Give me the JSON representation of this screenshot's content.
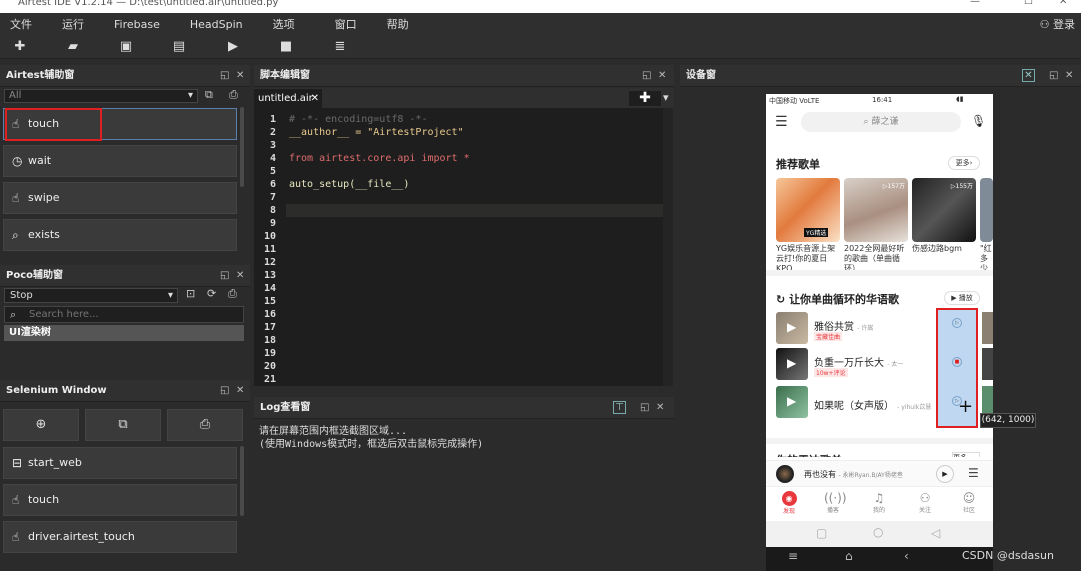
{
  "window": {
    "title": "Airtest IDE V1.2.14 — D:\\test\\untitled.air\\untitled.py"
  },
  "menu": [
    "文件",
    "运行",
    "Firebase",
    "HeadSpin",
    "选项",
    "窗口",
    "帮助"
  ],
  "login_label": "登录",
  "airtest_panel": {
    "title": "Airtest辅助窗",
    "filter": "All",
    "buttons": [
      "touch",
      "wait",
      "swipe",
      "exists"
    ]
  },
  "poco_panel": {
    "title": "Poco辅助窗",
    "mode": "Stop",
    "search_placeholder": "Search here...",
    "tree_item": "UI渲染树"
  },
  "selenium_panel": {
    "title": "Selenium Window",
    "buttons": [
      "start_web",
      "touch",
      "driver.airtest_touch"
    ]
  },
  "editor": {
    "title": "脚本编辑窗",
    "tab": "untitled.air",
    "lines": [
      {
        "n": "1",
        "text": "# -*- encoding=utf8 -*-"
      },
      {
        "n": "2",
        "text": "__author__ = \"AirtestProject\""
      },
      {
        "n": "3",
        "text": ""
      },
      {
        "n": "4",
        "text": "from airtest.core.api import *"
      },
      {
        "n": "5",
        "text": ""
      },
      {
        "n": "6",
        "text": "auto_setup(__file__)"
      },
      {
        "n": "7",
        "text": ""
      },
      {
        "n": "8",
        "text": ""
      },
      {
        "n": "9",
        "text": ""
      },
      {
        "n": "10",
        "text": ""
      },
      {
        "n": "11",
        "text": ""
      },
      {
        "n": "12",
        "text": ""
      },
      {
        "n": "13",
        "text": ""
      },
      {
        "n": "14",
        "text": ""
      },
      {
        "n": "15",
        "text": ""
      },
      {
        "n": "16",
        "text": ""
      },
      {
        "n": "17",
        "text": ""
      },
      {
        "n": "18",
        "text": ""
      },
      {
        "n": "19",
        "text": ""
      },
      {
        "n": "20",
        "text": ""
      },
      {
        "n": "21",
        "text": ""
      }
    ]
  },
  "log": {
    "title": "Log查看窗",
    "line1": "请在屏幕范围内框选截图区域...",
    "line2": "(使用Windows模式时，框选后双击鼠标完成操作)"
  },
  "device": {
    "title": "设备窗",
    "coord": "(642, 1000)",
    "status": {
      "carrier": "中国移动 VoLTE",
      "time": "16:41"
    },
    "search": "薛之谦",
    "rec_title": "推荐歌单",
    "more": "更多",
    "cards": [
      {
        "play": "",
        "caption": "YG娱乐音源上架云打!你的夏日KPO...",
        "badge": "YG精选"
      },
      {
        "play": "157万",
        "caption": "2022全网最好听的歌曲（单曲循环）",
        "badge": ""
      },
      {
        "play": "155万",
        "caption": "伤感边路bgm",
        "badge": ""
      },
      {
        "play": "",
        "caption": "\"红多少",
        "badge": ""
      }
    ],
    "loop_title": "让你单曲循环的华语歌",
    "play_all": "播放",
    "songs": [
      {
        "title": "雅俗共赏",
        "artist": "- 许嵩",
        "tag": "宝藏佳曲"
      },
      {
        "title": "负重一万斤长大",
        "artist": "- 太一",
        "tag": "10w+评论"
      },
      {
        "title": "如果呢（女声版）",
        "artist": "- yihuik苡慧",
        "tag": ""
      }
    ],
    "next_section": "你的雷达歌单",
    "next_more": "更多",
    "player": {
      "song": "再也没有",
      "artist": "- 永彬Ryan.B/AY杨佬叁"
    },
    "tabs": [
      "发现",
      "播客",
      "我的",
      "关注",
      "社区"
    ]
  },
  "watermark": "CSDN @dsdasun",
  "colors": {
    "accent": "#e8383d",
    "highlight": "#e02020",
    "selection": "#a9c9ec"
  }
}
